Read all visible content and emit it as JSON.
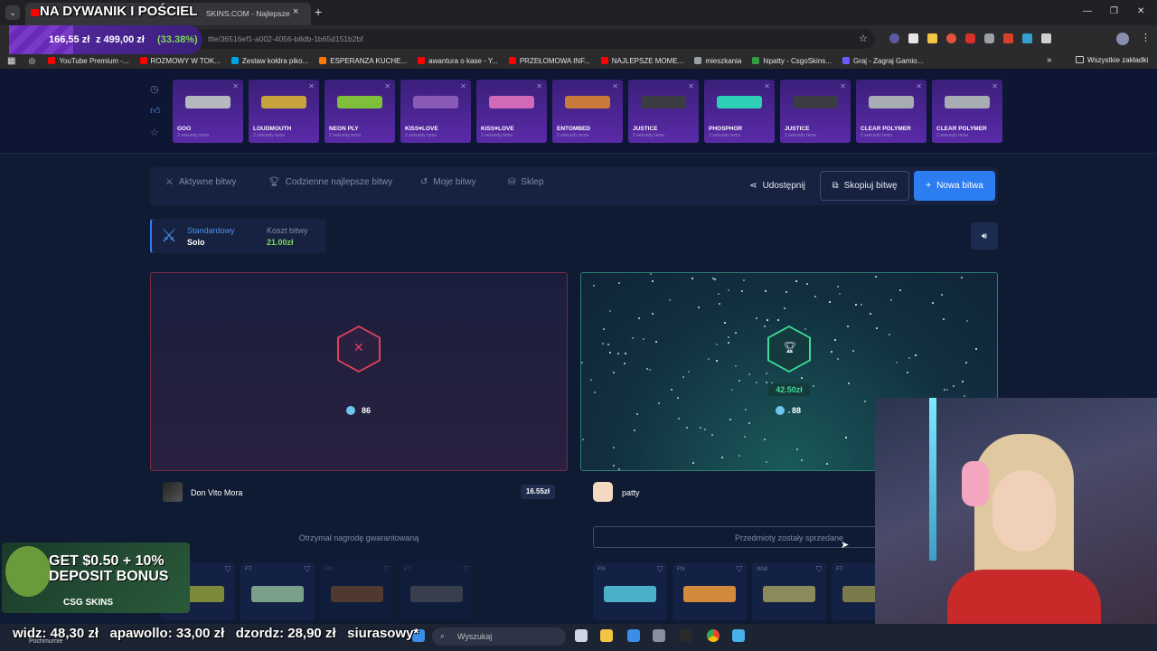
{
  "browser": {
    "tab_title": "SKINS.COM - Najlepsze",
    "tab_close": "×",
    "new_tab": "+",
    "url": "ttle/36516ef1-a002-4056-b8db-1b65d151b2bf",
    "window_controls": [
      "—",
      "❐",
      "✕"
    ],
    "bookmarks": [
      {
        "label": "YouTube Premium -...",
        "color": "#ff0000"
      },
      {
        "label": "ROZMOWY W TOK...",
        "color": "#ff0000"
      },
      {
        "label": "Zestaw kołdra piko...",
        "color": "#00a2e8"
      },
      {
        "label": "ESPERANZA KUCHE...",
        "color": "#ff7a00"
      },
      {
        "label": "awantura o kase - Y...",
        "color": "#ff0000"
      },
      {
        "label": "PRZEŁOMOWA INF...",
        "color": "#ff0000"
      },
      {
        "label": "NAJLEPSZE MOME...",
        "color": "#ff0000"
      },
      {
        "label": "mieszkania",
        "color": "#9aa0a6"
      },
      {
        "label": "hipatty - CsgoSkins...",
        "color": "#2ea043"
      },
      {
        "label": "Graj - Zagraj Gamio...",
        "color": "#6b5cff"
      }
    ],
    "all_bookmarks": "Wszystkie zakładki"
  },
  "overlay": {
    "goal_title": "NA DYWANIK I POŚCIEL",
    "goal_progress": "166,55 zł",
    "goal_target": "z 499,00 zł",
    "goal_percent": "(33.38%)",
    "goal_fraction": 0.3338,
    "promo_line1": "GET $0.50 + 10%",
    "promo_line2": "DEPOSIT BONUS",
    "promo_brand": "CSG SKINS",
    "ticker": "widz: 48,30 zł   apawollo: 33,00 zł   dzordz: 28,90 zł   siurasowy*"
  },
  "live_drops": [
    {
      "name": "GOO",
      "sub": "2 sekundy temu",
      "color": "#b5b9bf"
    },
    {
      "name": "LOUDMOUTH",
      "sub": "2 sekundy temu",
      "color": "#c8a23a"
    },
    {
      "name": "NEON PLY",
      "sub": "2 sekundy temu",
      "color": "#7fbf3c"
    },
    {
      "name": "KISS♥LOVE",
      "sub": "2 sekundy temu",
      "color": "#8a5ab8"
    },
    {
      "name": "KISS♥LOVE",
      "sub": "2 sekundy temu",
      "color": "#d06ab8"
    },
    {
      "name": "ENTOMBED",
      "sub": "2 sekundy temu",
      "color": "#c87a3a"
    },
    {
      "name": "JUSTICE",
      "sub": "2 sekundy temu",
      "color": "#3c3c44"
    },
    {
      "name": "PHOSPHOR",
      "sub": "2 sekundy temu",
      "color": "#2ecfb4"
    },
    {
      "name": "JUSTICE",
      "sub": "2 sekundy temu",
      "color": "#3c3c44"
    },
    {
      "name": "CLEAR POLYMER",
      "sub": "2 sekundy temu",
      "color": "#a8adb4"
    },
    {
      "name": "CLEAR POLYMER",
      "sub": "2 sekundy temu",
      "color": "#a8adb4"
    }
  ],
  "nav": {
    "active_battles": "Aktywne bitwy",
    "daily_best": "Codzienne najlepsze bitwy",
    "my_battles": "Moje bitwy",
    "shop": "Sklep",
    "share": "Udostępnij",
    "copy": "Skopiuj bitwę",
    "new_battle": "Nowa bitwa"
  },
  "battle_info": {
    "mode_label": "Standardowy",
    "mode_value": "Solo",
    "cost_label": "Koszt bitwy",
    "cost_value": "21.00zł"
  },
  "players": [
    {
      "name": "Don Vito Mora",
      "total": "16.55zł",
      "tickets": "86",
      "status": "Otrzymał nagrodę gwarantowaną",
      "result": "lose",
      "items": [
        {
          "wear": "FT",
          "color": "#7d8a3a"
        },
        {
          "wear": "FT",
          "color": "#7aa08a"
        },
        {
          "wear": "FN",
          "color": "#a0602a"
        },
        {
          "wear": "FT",
          "color": "#6a6a6a"
        }
      ]
    },
    {
      "name": "patty",
      "total": "",
      "prize": "42.50zł",
      "tickets": "88",
      "status": "Przedmioty zostały sprzedane",
      "result": "win",
      "items": [
        {
          "wear": "FN",
          "color": "#4ab0c8"
        },
        {
          "wear": "FN",
          "color": "#d08a3a"
        },
        {
          "wear": "WW",
          "color": "#8a8a5a"
        },
        {
          "wear": "FT",
          "color": "#7a7a4a"
        }
      ]
    }
  ],
  "taskbar": {
    "search_placeholder": "Wyszukaj",
    "weather": "Pochmurnie"
  }
}
